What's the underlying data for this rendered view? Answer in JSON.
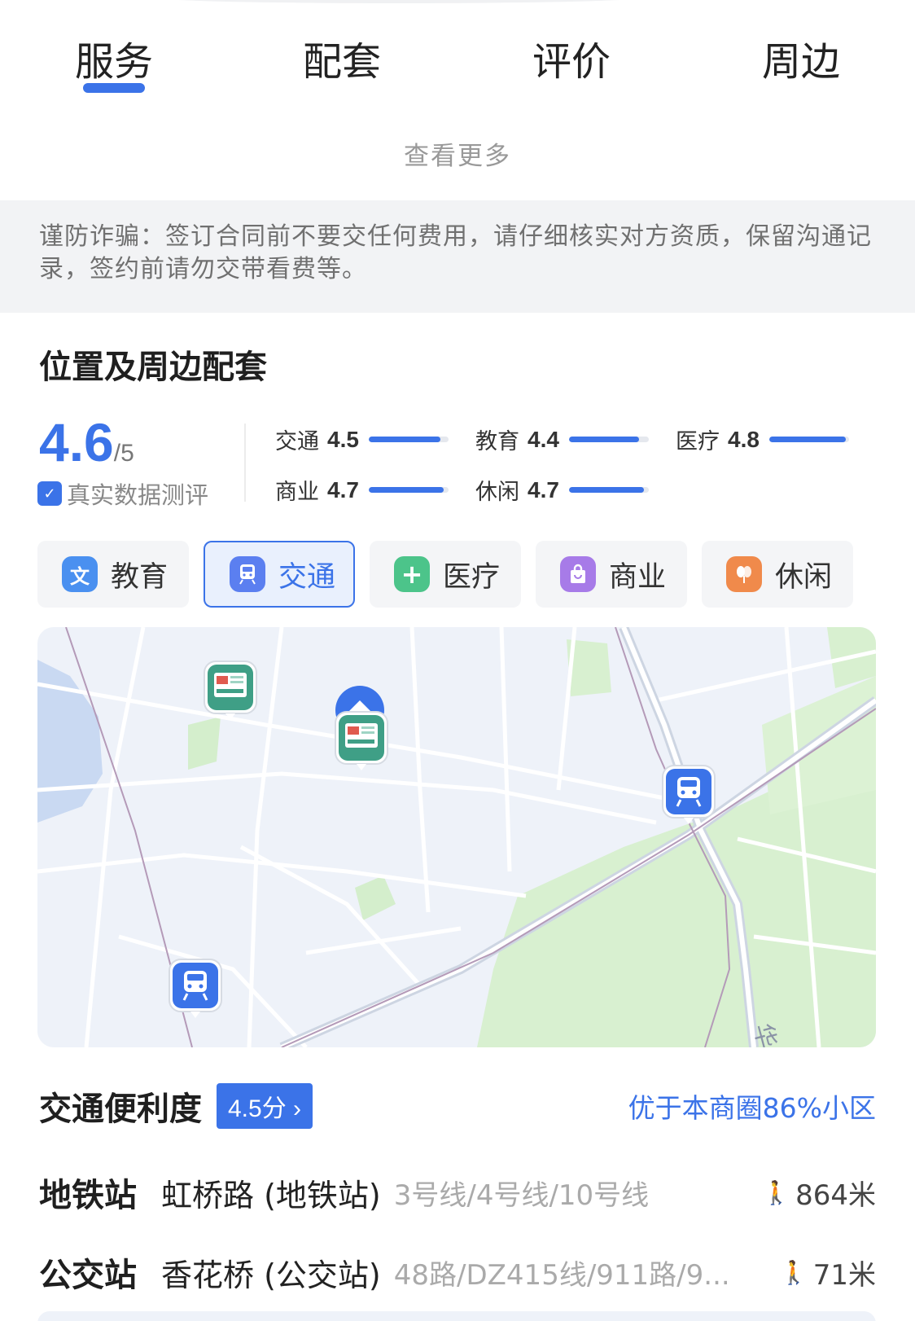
{
  "tabs": [
    {
      "label": "服务"
    },
    {
      "label": "配套"
    },
    {
      "label": "评价"
    },
    {
      "label": "周边"
    }
  ],
  "active_tab": "服务",
  "see_more": "查看更多",
  "notice": "谨防诈骗：签订合同前不要交任何费用，请仔细核实对方资质，保留沟通记录，签约前请勿交带看费等。",
  "section_title": "位置及周边配套",
  "overall": {
    "score": "4.6",
    "denominator": "/5",
    "label": "真实数据测评"
  },
  "metrics": [
    {
      "name": "交通",
      "value": "4.5",
      "level": 0.9
    },
    {
      "name": "教育",
      "value": "4.4",
      "level": 0.88
    },
    {
      "name": "医疗",
      "value": "4.8",
      "level": 0.96
    },
    {
      "name": "商业",
      "value": "4.7",
      "level": 0.94
    },
    {
      "name": "休闲",
      "value": "4.7",
      "level": 0.94
    }
  ],
  "categories": [
    {
      "label": "教育",
      "icon": "education-icon",
      "glyph": "文",
      "color": "#4a90f0",
      "active": false
    },
    {
      "label": "交通",
      "icon": "transit-icon",
      "glyph": "▣",
      "color": "#5b7ff0",
      "active": true
    },
    {
      "label": "医疗",
      "icon": "medical-icon",
      "glyph": "+",
      "color": "#4cc48a",
      "active": false
    },
    {
      "label": "商业",
      "icon": "shopping-icon",
      "glyph": "▢",
      "color": "#a77be8",
      "active": false
    },
    {
      "label": "休闲",
      "icon": "leisure-icon",
      "glyph": "◍",
      "color": "#f08a4b",
      "active": false
    }
  ],
  "map": {
    "road_label": "华山路",
    "markers": [
      "bus-stop-marker",
      "bus-stop-marker",
      "home-marker",
      "subway-station-marker",
      "subway-station-marker"
    ]
  },
  "convenience": {
    "title": "交通便利度",
    "badge": "4.5分 ›",
    "compare": "优于本商圈86%小区"
  },
  "pois": [
    {
      "type": "地铁站",
      "name": "虹桥路 (地铁站)",
      "lines": "3号线/4号线/10号线",
      "distance": "864米"
    },
    {
      "type": "公交站",
      "name": "香花桥 (公交站)",
      "lines": "48路/DZ415线/911路/9...",
      "distance": "71米"
    }
  ],
  "colors": {
    "accent": "#3b73e8",
    "map_background": "#eef2f9",
    "park_green": "#d8f0d0",
    "bus_marker": "#3f9f86"
  }
}
